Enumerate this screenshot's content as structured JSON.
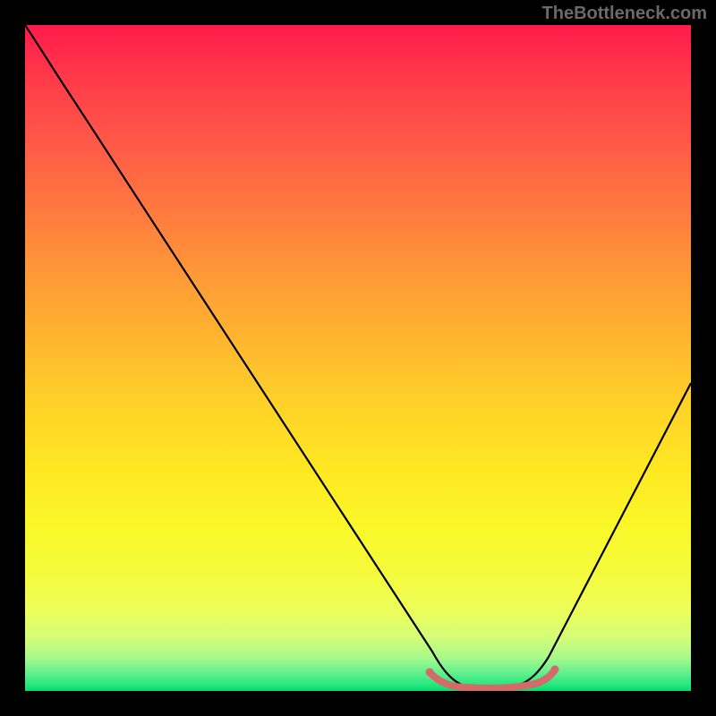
{
  "attribution": "TheBottleneck.com",
  "chart_data": {
    "type": "line",
    "title": "",
    "xlabel": "",
    "ylabel": "",
    "xlim": [
      0,
      100
    ],
    "ylim": [
      0,
      100
    ],
    "series": [
      {
        "name": "bottleneck-curve",
        "x": [
          0,
          5,
          10,
          20,
          30,
          40,
          50,
          58,
          62,
          66,
          70,
          74,
          78,
          85,
          92,
          100
        ],
        "y": [
          100,
          95,
          88,
          73,
          58,
          43,
          28,
          12,
          4,
          0.5,
          0.2,
          0.5,
          3,
          14,
          30,
          50
        ]
      },
      {
        "name": "optimal-range-marker",
        "x": [
          61,
          63,
          66,
          70,
          74,
          77,
          79
        ],
        "y": [
          2.5,
          0.8,
          0.3,
          0.2,
          0.4,
          1.2,
          3.2
        ]
      }
    ],
    "background_gradient": {
      "top": "#ff1a4a",
      "mid": "#ffe822",
      "bottom": "#00de6a"
    },
    "marker_color": "#d46a6a"
  }
}
